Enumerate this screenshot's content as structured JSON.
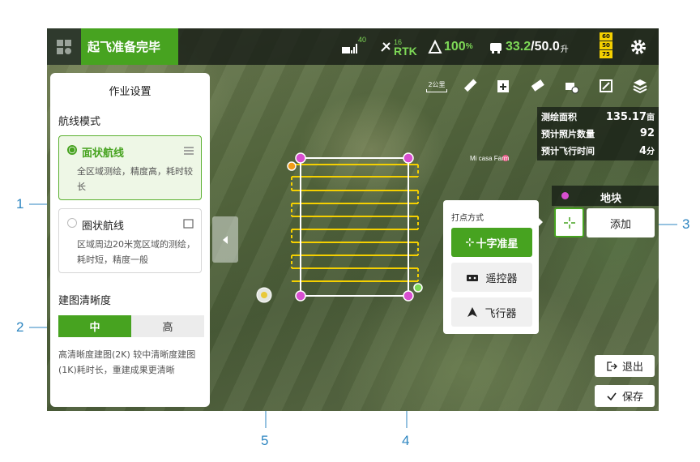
{
  "topbar": {
    "status": "起飞准备完毕",
    "signal_count": "40",
    "rtk_count": "16",
    "rtk_label": "RTK",
    "battery": "100",
    "battery_unit": "%",
    "tank_current": "33.2",
    "tank_total": "/50.0",
    "tank_unit": "升",
    "remote_batt": [
      "60",
      "50",
      "75"
    ]
  },
  "panel": {
    "title": "作业设置",
    "route_mode_label": "航线模式",
    "modes": [
      {
        "title": "面状航线",
        "desc": "全区域测绘，精度高，耗时较长",
        "selected": true
      },
      {
        "title": "圈状航线",
        "desc": "区域周边20米宽区域的测绘，耗时短，精度一般",
        "selected": false
      }
    ],
    "resolution_label": "建图清晰度",
    "resolution_options": [
      "中",
      "高"
    ],
    "resolution_selected": "中",
    "resolution_desc": "高清晰度建图(2K) 较中清晰度建图(1K)耗时长，重建成果更清晰"
  },
  "toolbar": {
    "scale": "2公里",
    "icons": [
      "ruler-icon",
      "add-folder-icon",
      "eraser-icon",
      "drone-settings-icon",
      "map-locate-icon",
      "layers-icon"
    ]
  },
  "stats": [
    {
      "label": "测绘面积",
      "value": "135.17",
      "unit": "亩"
    },
    {
      "label": "预计照片数量",
      "value": "92",
      "unit": ""
    },
    {
      "label": "预计飞行时间",
      "value": "4",
      "unit": "分"
    }
  ],
  "map": {
    "place_label": "Mi casa Farm"
  },
  "plot": {
    "title": "地块",
    "add_label": "添加"
  },
  "point_method": {
    "label": "打点方式",
    "options": [
      "十字准星",
      "遥控器",
      "飞行器"
    ],
    "selected": "十字准星"
  },
  "buttons": {
    "exit": "退出",
    "save": "保存"
  },
  "callouts": [
    "1",
    "2",
    "3",
    "4",
    "5"
  ],
  "colors": {
    "accent": "#47a320",
    "callout": "#2e86c1",
    "vertex": "#d84fd0",
    "route": "#f5d000"
  }
}
